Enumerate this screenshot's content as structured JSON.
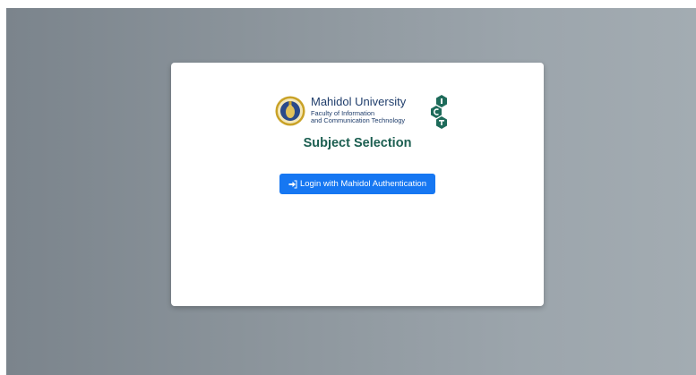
{
  "header": {
    "university_name": "Mahidol University",
    "faculty_line1": "Faculty of Information",
    "faculty_line2": "and Communication Technology"
  },
  "page": {
    "title": "Subject Selection"
  },
  "login": {
    "button_label": "Login with Mahidol Authentication",
    "icon": "sign-in-icon"
  },
  "colors": {
    "primary_button": "#1677f2",
    "title_green": "#1b5e50",
    "logo_blue": "#1f3d6b",
    "ict_green": "#1e6b5a",
    "seal_gold": "#c9a227"
  },
  "logos": {
    "seal_icon": "mahidol-seal-icon",
    "ict_icon": "ict-hexagon-logo-icon"
  }
}
